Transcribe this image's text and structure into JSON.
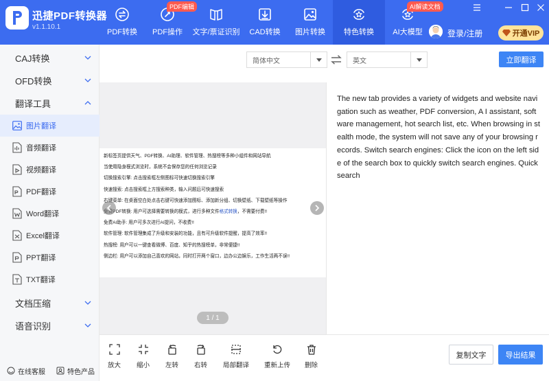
{
  "app": {
    "name": "迅捷PDF转换器",
    "version": "v1.1.10.1"
  },
  "nav": {
    "items": [
      {
        "label": "PDF转换",
        "icon": "convert-icon"
      },
      {
        "label": "PDF操作",
        "icon": "pdf-edit-icon",
        "badge": "PDF编辑"
      },
      {
        "label": "文字/票证识别",
        "icon": "ocr-icon"
      },
      {
        "label": "CAD转换",
        "icon": "cad-icon"
      },
      {
        "label": "图片转换",
        "icon": "image-icon"
      },
      {
        "label": "特色转换",
        "icon": "feature-icon",
        "active": true
      },
      {
        "label": "AI大模型",
        "icon": "ai-icon",
        "badge": "AI解读文档"
      }
    ],
    "login": "登录/注册",
    "vip": "开通VIP"
  },
  "sidebar": {
    "groups": [
      {
        "label": "CAJ转换"
      },
      {
        "label": "OFD转换"
      },
      {
        "label": "翻译工具"
      },
      {
        "label": "文档压缩"
      },
      {
        "label": "语音识别"
      }
    ],
    "items": [
      {
        "label": "图片翻译",
        "icon": "image-icon",
        "active": true
      },
      {
        "label": "音频翻译",
        "icon": "audio-file-icon"
      },
      {
        "label": "视频翻译",
        "icon": "video-file-icon"
      },
      {
        "label": "PDF翻译",
        "icon": "pdf-file-icon"
      },
      {
        "label": "Word翻译",
        "icon": "word-file-icon"
      },
      {
        "label": "Excel翻译",
        "icon": "excel-file-icon"
      },
      {
        "label": "PPT翻译",
        "icon": "ppt-file-icon"
      },
      {
        "label": "TXT翻译",
        "icon": "txt-file-icon"
      }
    ],
    "service": "在线客服",
    "featured": "特色产品"
  },
  "translate": {
    "source_lang": "简体中文",
    "target_lang": "英文",
    "translate_button": "立即翻译"
  },
  "document": {
    "lines": [
      "新标签页提供天气、PDF转换、AI助理、软件管理、热搜榜等多种小组件和网站导航",
      "当使用隐身模式浏览时，系统不会保存您的任何浏览记录",
      "切换搜索引擎: 点击搜索框左侧图标可快速切换搜索引擎",
      "快速搜索: 点击搜索框上方搜索种类，输入问题后可快速搜索",
      "右键菜单: 在桌面空白处点击右键可快速添加图标、添加新分组、切换壁纸、下载壁纸等操作",
      "免费PDF转换: 用户可选择需要转换的模式，进行多种文件格式转换，不需要付费!!",
      "免费AI助手: 用户可多次进行AI提问，不收费!!",
      "软件管理: 软件管理集成了升级和安装的功能，且有可升级软件提醒，提高了效率!!",
      "热搜榜: 用户可以一键查看微博、百度、知乎的热搜榜单，非常便捷!!",
      "侧边栏: 用户可以添加自己喜欢的网站，同时打开两个窗口，边办公边娱乐，工作生活两不误!!"
    ],
    "highlight": "格式转换",
    "page": "1 / 1"
  },
  "result": {
    "text": "The new tab provides a variety of widgets and website navigation such as weather, PDF conversion, A I assistant, software management, hot search list, etc. When browsing in stealth mode, the system will not save any of your browsing records. Switch search engines: Click the icon on the left side of the search box to quickly switch search engines. Quick search"
  },
  "tools": [
    {
      "label": "放大",
      "icon": "zoom-in-icon"
    },
    {
      "label": "缩小",
      "icon": "zoom-out-icon"
    },
    {
      "label": "左转",
      "icon": "rotate-left-icon"
    },
    {
      "label": "右转",
      "icon": "rotate-right-icon"
    },
    {
      "label": "局部翻译",
      "icon": "partial-translate-icon"
    },
    {
      "label": "重新上传",
      "icon": "reupload-icon"
    },
    {
      "label": "删除",
      "icon": "trash-icon"
    }
  ],
  "actions": {
    "copy": "复制文字",
    "export": "导出结果"
  },
  "colors": {
    "brand": "#3c6cf0",
    "brand_active": "#2f5ce0",
    "primary_button": "#3d85f5",
    "badge": "#ff5a4f",
    "vip": "#ffe39a"
  }
}
